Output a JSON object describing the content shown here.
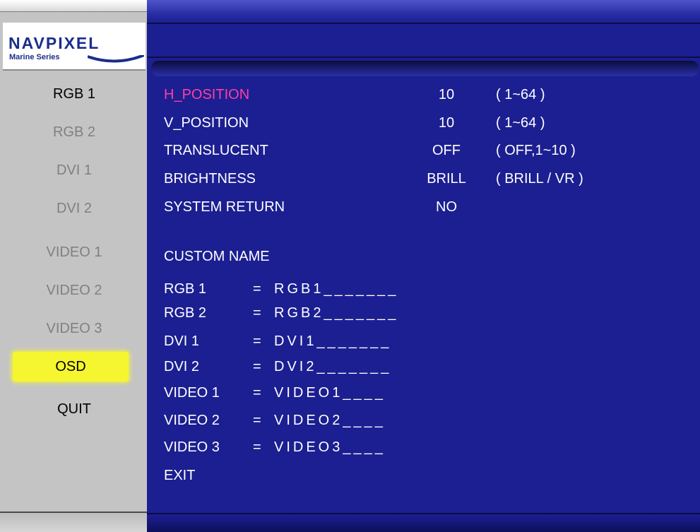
{
  "brand": {
    "name": "NAVPIXEL",
    "subtitle": "Marine Series"
  },
  "sidebar": {
    "items": [
      {
        "label": "RGB 1",
        "state": "active"
      },
      {
        "label": "RGB 2",
        "state": "inactive"
      },
      {
        "label": "DVI 1",
        "state": "inactive"
      },
      {
        "label": "DVI 2",
        "state": "inactive"
      },
      {
        "label": "VIDEO 1",
        "state": "inactive"
      },
      {
        "label": "VIDEO 2",
        "state": "inactive"
      },
      {
        "label": "VIDEO 3",
        "state": "inactive"
      },
      {
        "label": "OSD",
        "state": "selected"
      },
      {
        "label": "QUIT",
        "state": "active"
      }
    ]
  },
  "settings": [
    {
      "label": "H_POSITION",
      "value": "10",
      "range": "( 1~64 )",
      "highlight": true
    },
    {
      "label": "V_POSITION",
      "value": "10",
      "range": "( 1~64 )"
    },
    {
      "label": "TRANSLUCENT",
      "value": "OFF",
      "range": "( OFF,1~10 )"
    },
    {
      "label": "BRIGHTNESS",
      "value": "BRILL",
      "range": "( BRILL / VR )"
    },
    {
      "label": "SYSTEM RETURN",
      "value": "NO",
      "range": ""
    }
  ],
  "custom_name": {
    "heading": "CUSTOM NAME",
    "entries": [
      {
        "label": "RGB 1",
        "value": "RGB1_______"
      },
      {
        "label": "RGB 2",
        "value": "RGB2_______"
      },
      {
        "label": "DVI 1",
        "value": "DVI1_______"
      },
      {
        "label": "DVI 2",
        "value": "DVI2_______"
      },
      {
        "label": "VIDEO 1",
        "value": "VIDEO1____"
      },
      {
        "label": "VIDEO 2",
        "value": "VIDEO2____"
      },
      {
        "label": "VIDEO 3",
        "value": "VIDEO3____"
      }
    ]
  },
  "exit_label": "EXIT",
  "equals": "=",
  "colors": {
    "panel": "#1c1f91",
    "sidebar": "#c4c4c4",
    "highlight_text": "#ff3fa0",
    "selected_bg": "#f5f530"
  }
}
